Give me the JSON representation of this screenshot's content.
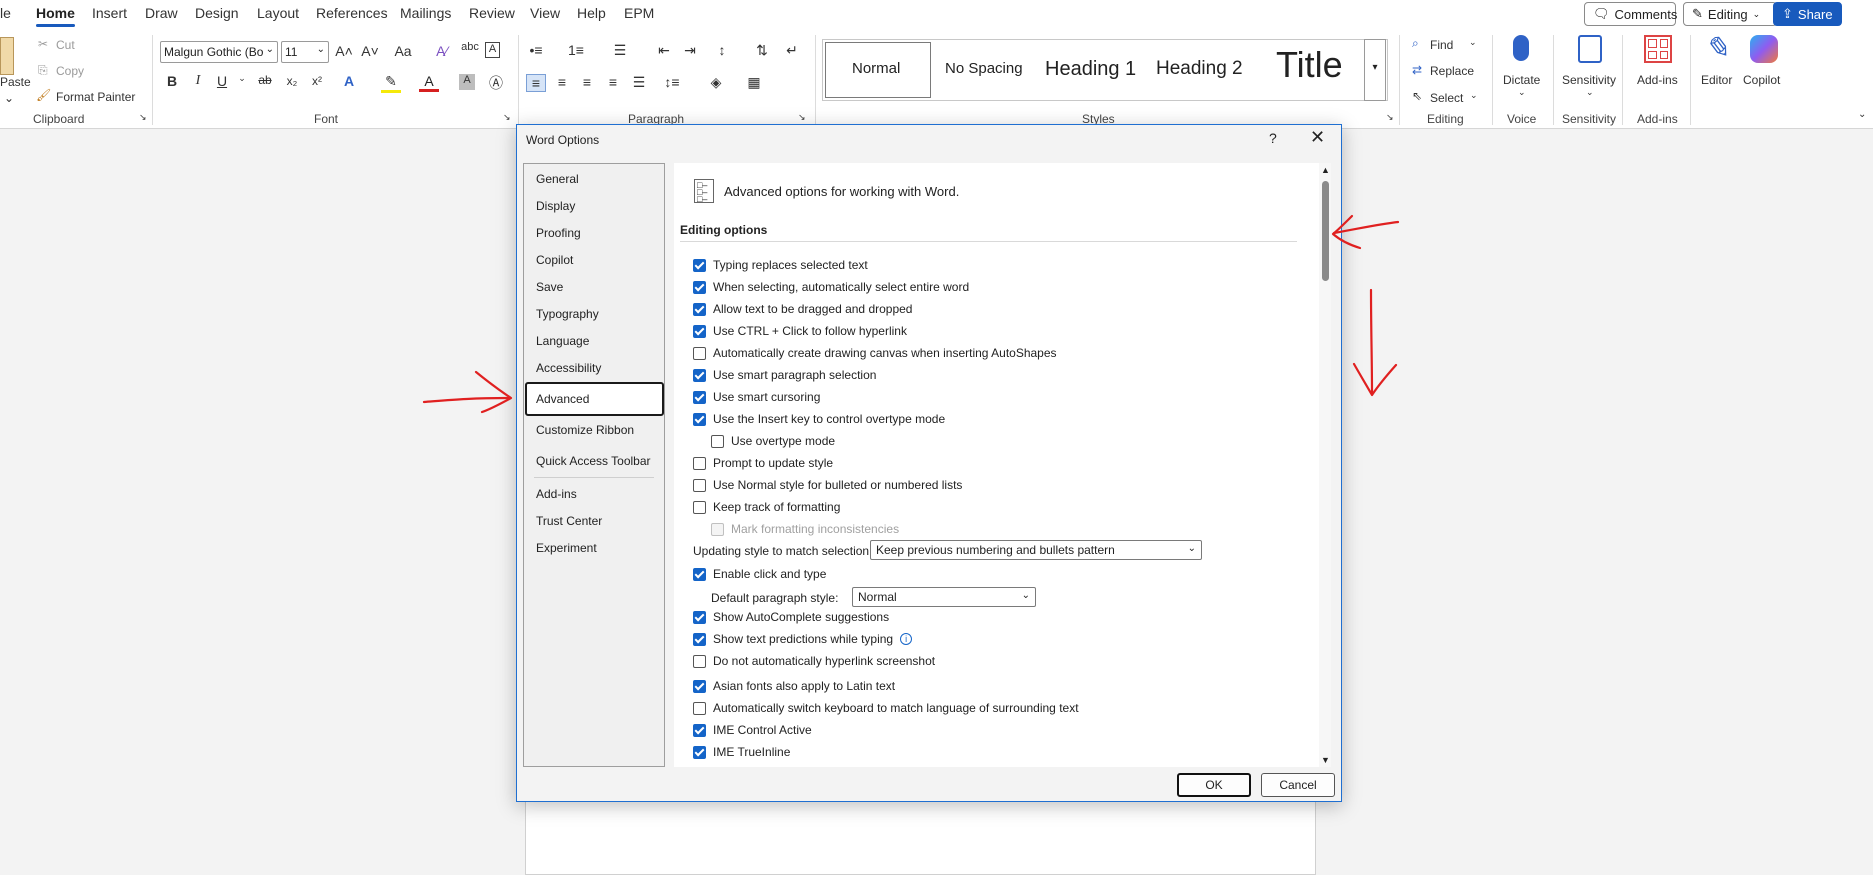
{
  "menu": {
    "tabs": [
      {
        "label": "le"
      },
      {
        "label": "Home"
      },
      {
        "label": "Insert"
      },
      {
        "label": "Draw"
      },
      {
        "label": "Design"
      },
      {
        "label": "Layout"
      },
      {
        "label": "References"
      },
      {
        "label": "Mailings"
      },
      {
        "label": "Review"
      },
      {
        "label": "View"
      },
      {
        "label": "Help"
      },
      {
        "label": "EPM"
      }
    ],
    "comments": "Comments",
    "editing": "Editing",
    "share": "Share"
  },
  "ribbon": {
    "clipboard": {
      "paste": "Paste",
      "cut": "Cut",
      "copy": "Copy",
      "format_painter": "Format Painter",
      "label": "Clipboard"
    },
    "font": {
      "name": "Malgun Gothic (Bo",
      "size": "11",
      "label": "Font"
    },
    "paragraph": {
      "label": "Paragraph"
    },
    "styles": {
      "items": [
        "Normal",
        "No Spacing",
        "Heading 1",
        "Heading 2",
        "Title"
      ],
      "label": "Styles"
    },
    "editing": {
      "find": "Find",
      "replace": "Replace",
      "select": "Select",
      "label": "Editing"
    },
    "voice": {
      "dictate": "Dictate",
      "label": "Voice"
    },
    "sensitivity": {
      "button": "Sensitivity",
      "label": "Sensitivity"
    },
    "addins": {
      "button": "Add-ins",
      "label": "Add-ins"
    },
    "editor": "Editor",
    "copilot": "Copilot"
  },
  "dialog": {
    "title": "Word Options",
    "help": "?",
    "nav": [
      "General",
      "Display",
      "Proofing",
      "Copilot",
      "Save",
      "Typography",
      "Language",
      "Accessibility",
      "Advanced",
      "Customize Ribbon",
      "Quick Access Toolbar",
      "Add-ins",
      "Trust Center",
      "Experiment"
    ],
    "selected_nav": "Advanced",
    "header": "Advanced options for working with Word.",
    "section": "Editing options",
    "options": [
      {
        "label": "Typing replaces selected text",
        "checked": true
      },
      {
        "label": "When selecting, automatically select entire word",
        "checked": true
      },
      {
        "label": "Allow text to be dragged and dropped",
        "checked": true
      },
      {
        "label": "Use CTRL + Click to follow hyperlink",
        "checked": true
      },
      {
        "label": "Automatically create drawing canvas when inserting AutoShapes",
        "checked": false
      },
      {
        "label": "Use smart paragraph selection",
        "checked": true
      },
      {
        "label": "Use smart cursoring",
        "checked": true
      },
      {
        "label": "Use the Insert key to control overtype mode",
        "checked": true
      },
      {
        "label": "Use overtype mode",
        "checked": false
      },
      {
        "label": "Prompt to update style",
        "checked": false
      },
      {
        "label": "Use Normal style for bulleted or numbered lists",
        "checked": false
      },
      {
        "label": "Keep track of formatting",
        "checked": false
      },
      {
        "label": "Mark formatting inconsistencies",
        "checked": false,
        "disabled": true
      }
    ],
    "updating_style_label": "Updating style to match selection:",
    "updating_style_value": "Keep previous numbering and bullets pattern",
    "click_and_type": {
      "label": "Enable click and type",
      "checked": true
    },
    "default_para_label": "Default paragraph style:",
    "default_para_value": "Normal",
    "options2": [
      {
        "label": "Show AutoComplete suggestions",
        "checked": true
      },
      {
        "label": "Show text predictions while typing",
        "checked": true
      },
      {
        "label": "Do not automatically hyperlink screenshot",
        "checked": false
      },
      {
        "label": "Asian fonts also apply to Latin text",
        "checked": true
      },
      {
        "label": "Automatically switch keyboard to match language of surrounding text",
        "checked": false
      },
      {
        "label": "IME Control Active",
        "checked": true
      },
      {
        "label": "IME TrueInline",
        "checked": true
      }
    ],
    "ok": "OK",
    "cancel": "Cancel"
  },
  "colors": {
    "accent": "#185abd",
    "annotation": "#e02020"
  }
}
